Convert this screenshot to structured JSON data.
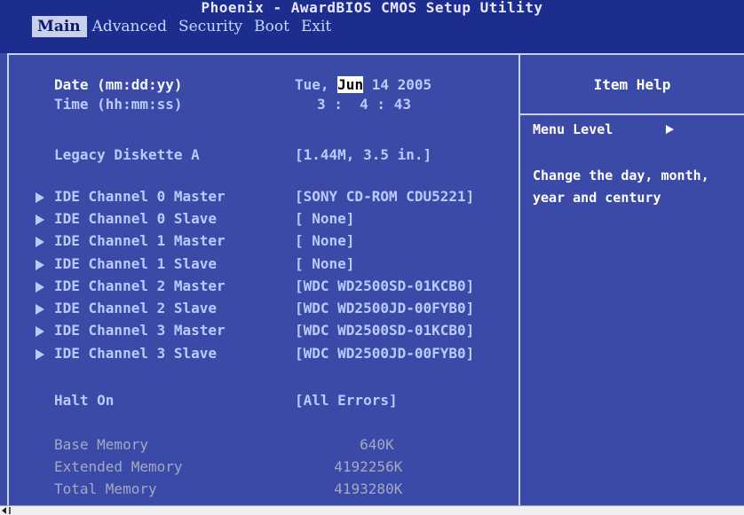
{
  "title": "Phoenix - AwardBIOS CMOS Setup Utility",
  "menu": [
    "Main",
    "Advanced",
    "Security",
    "Boot",
    "Exit"
  ],
  "main": {
    "date": {
      "label": "Date (mm:dd:yy)",
      "weekday": "Tue,",
      "month": "Jun",
      "rest": " 14 2005"
    },
    "time": {
      "label": "Time (hh:mm:ss)",
      "value": "3 :  4 : 43"
    },
    "diskette": {
      "label": "Legacy Diskette A",
      "value": "[1.44M, 3.5 in.]"
    },
    "ide": [
      {
        "label": "IDE Channel 0 Master",
        "value": "[SONY CD-ROM CDU5221]"
      },
      {
        "label": "IDE Channel 0 Slave",
        "value": "[ None]"
      },
      {
        "label": "IDE Channel 1 Master",
        "value": "[ None]"
      },
      {
        "label": "IDE Channel 1 Slave",
        "value": "[ None]"
      },
      {
        "label": "IDE Channel 2 Master",
        "value": "[WDC WD2500SD-01KCB0]"
      },
      {
        "label": "IDE Channel 2 Slave",
        "value": "[WDC WD2500JD-00FYB0]"
      },
      {
        "label": "IDE Channel 3 Master",
        "value": "[WDC WD2500SD-01KCB0]"
      },
      {
        "label": "IDE Channel 3 Slave",
        "value": "[WDC WD2500JD-00FYB0]"
      }
    ],
    "halt": {
      "label": "Halt On",
      "value": "[All Errors]"
    },
    "memory": [
      {
        "label": "Base Memory",
        "value": "     640K"
      },
      {
        "label": "Extended Memory",
        "value": "  4192256K"
      },
      {
        "label": "Total Memory",
        "value": "  4193280K"
      }
    ]
  },
  "help": {
    "title": "Item Help",
    "menu_level": "Menu Level",
    "text": "Change the day, month, year and century"
  }
}
